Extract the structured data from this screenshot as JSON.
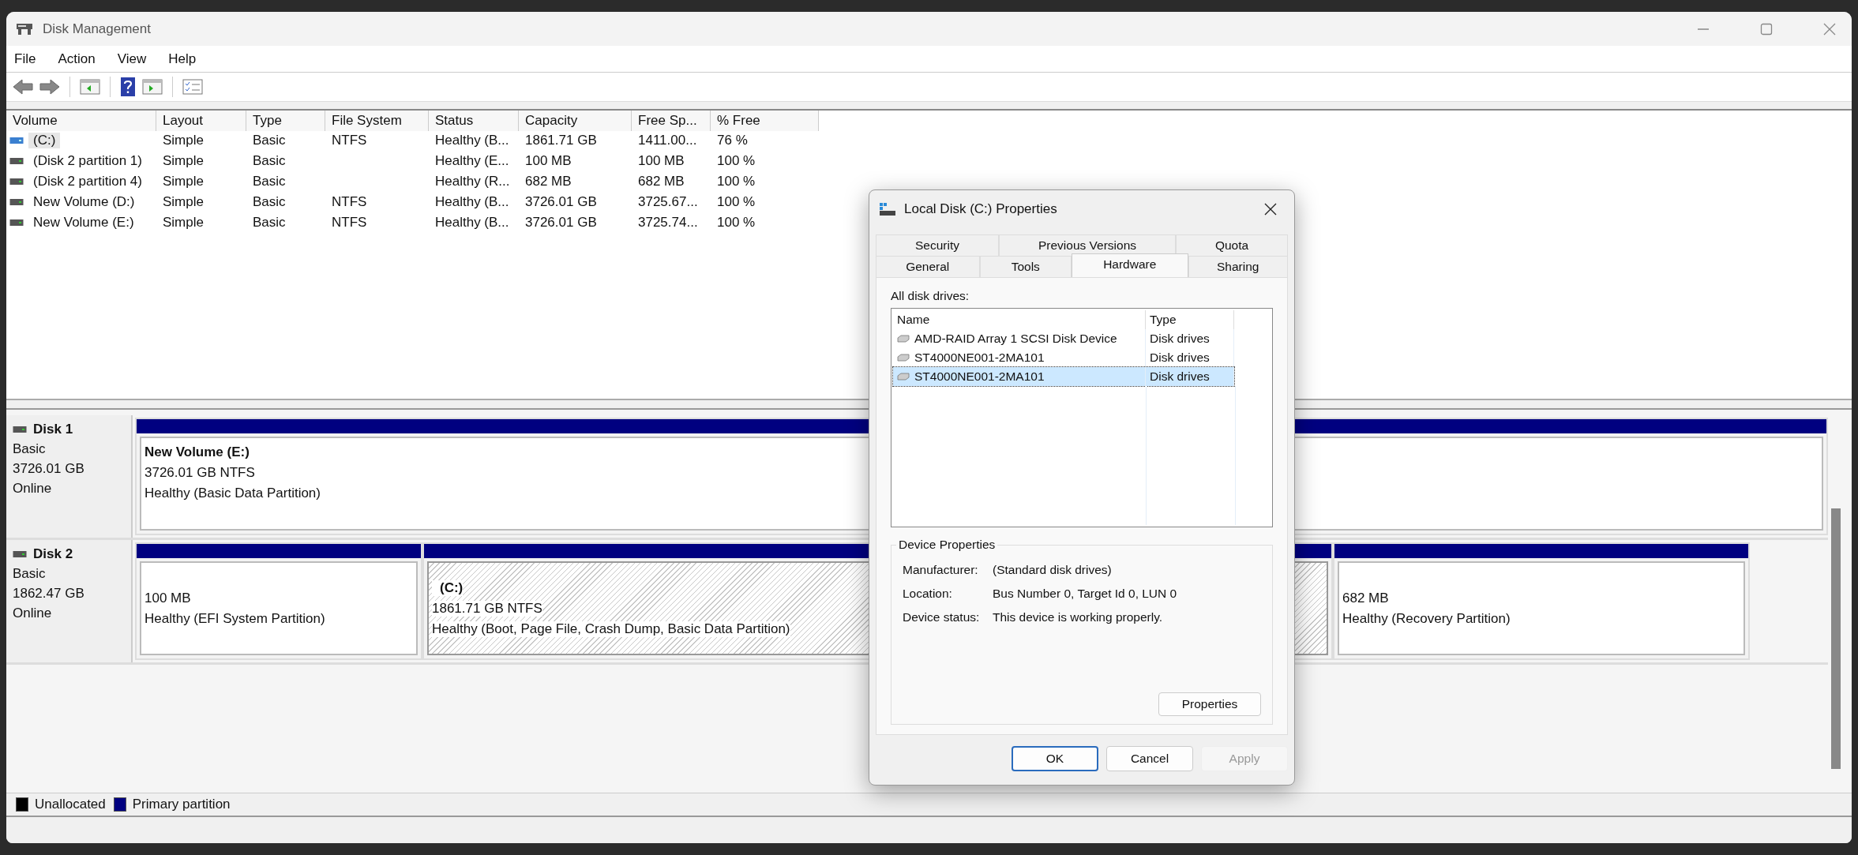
{
  "window": {
    "title": "Disk Management"
  },
  "menu": [
    "File",
    "Action",
    "View",
    "Help"
  ],
  "volumes": {
    "columns": [
      "Volume",
      "Layout",
      "Type",
      "File System",
      "Status",
      "Capacity",
      "Free Sp...",
      "% Free"
    ],
    "rows": [
      {
        "volume": "(C:)",
        "kind": "system",
        "layout": "Simple",
        "type": "Basic",
        "file_system": "NTFS",
        "status": "Healthy (B...",
        "capacity": "1861.71 GB",
        "free_space": "1411.00...",
        "percent_free": "76 %",
        "selected": true
      },
      {
        "volume": "(Disk 2 partition 1)",
        "kind": "data",
        "layout": "Simple",
        "type": "Basic",
        "status": "Healthy (E...",
        "capacity": "100 MB",
        "free_space": "100 MB",
        "percent_free": "100 %",
        "selected": false
      },
      {
        "volume": "(Disk 2 partition 4)",
        "kind": "data",
        "layout": "Simple",
        "type": "Basic",
        "status": "Healthy (R...",
        "capacity": "682 MB",
        "free_space": "682 MB",
        "percent_free": "100 %",
        "selected": false
      },
      {
        "volume": "New Volume (D:)",
        "kind": "data",
        "layout": "Simple",
        "type": "Basic",
        "file_system": "NTFS",
        "status": "Healthy (B...",
        "capacity": "3726.01 GB",
        "free_space": "3725.67...",
        "percent_free": "100 %",
        "selected": false
      },
      {
        "volume": "New Volume (E:)",
        "kind": "data",
        "layout": "Simple",
        "type": "Basic",
        "file_system": "NTFS",
        "status": "Healthy (B...",
        "capacity": "3726.01 GB",
        "free_space": "3725.74...",
        "percent_free": "100 %",
        "selected": false
      }
    ]
  },
  "disks": [
    {
      "name": "Disk 1",
      "type": "Basic",
      "size": "3726.01 GB",
      "status": "Online",
      "partitions": [
        {
          "title": "New Volume  (E:)",
          "size": "3726.01 GB NTFS",
          "status": "Healthy (Basic Data Partition)",
          "selected": false
        }
      ]
    },
    {
      "name": "Disk 2",
      "type": "Basic",
      "size": "1862.47 GB",
      "status": "Online",
      "partitions": [
        {
          "size": "100 MB",
          "status": "Healthy (EFI System Partition)",
          "selected": false
        },
        {
          "title": "(C:)",
          "size": "1861.71 GB NTFS",
          "status": "Healthy (Boot, Page File, Crash Dump, Basic Data Partition)",
          "selected": true
        },
        {
          "size": "682 MB",
          "status": "Healthy (Recovery Partition)",
          "selected": false
        }
      ]
    }
  ],
  "legend": [
    {
      "label": "Unallocated",
      "color": "#000000"
    },
    {
      "label": "Primary partition",
      "color": "#000080"
    }
  ],
  "dialog": {
    "title": "Local Disk (C:) Properties",
    "tab_rows": [
      [
        {
          "label": "Security",
          "selected": false
        },
        {
          "label": "Previous Versions",
          "selected": false
        },
        {
          "label": "Quota",
          "selected": false
        }
      ],
      [
        {
          "label": "General",
          "selected": false
        },
        {
          "label": "Tools",
          "selected": false
        },
        {
          "label": "Hardware",
          "selected": true
        },
        {
          "label": "Sharing",
          "selected": false
        }
      ]
    ],
    "list_label": "All disk drives:",
    "list": {
      "columns": [
        "Name",
        "Type"
      ],
      "rows": [
        {
          "name": "AMD-RAID Array 1  SCSI Disk Device",
          "type": "Disk drives",
          "selected": false
        },
        {
          "name": "ST4000NE001-2MA101",
          "type": "Disk drives",
          "selected": false
        },
        {
          "name": "ST4000NE001-2MA101",
          "type": "Disk drives",
          "selected": true
        }
      ]
    },
    "group": {
      "title": "Device Properties",
      "fields": [
        {
          "label": "Manufacturer:",
          "value": "(Standard disk drives)"
        },
        {
          "label": "Location:",
          "value": "Bus Number 0, Target Id 0, LUN 0"
        },
        {
          "label": "Device status:",
          "value": "This device is working properly."
        }
      ],
      "button": "Properties"
    },
    "buttons": [
      {
        "label": "OK",
        "default": true,
        "disabled": false
      },
      {
        "label": "Cancel",
        "default": false,
        "disabled": false
      },
      {
        "label": "Apply",
        "default": false,
        "disabled": true
      }
    ]
  }
}
